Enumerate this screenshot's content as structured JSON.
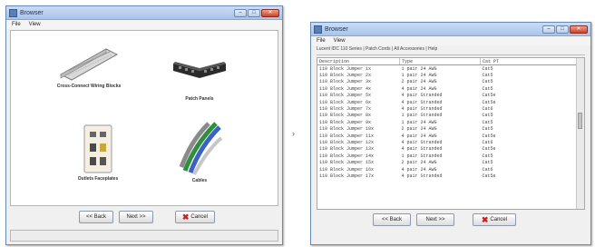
{
  "left_window": {
    "title": "Browser",
    "menu": [
      "File",
      "View"
    ],
    "tiles": [
      "Cross-Connect Wiring Blocks",
      "Patch Panels",
      "Outlets Faceplates",
      "Cables"
    ],
    "buttons": {
      "back": "<< Back",
      "next": "Next >>",
      "cancel": "Cancel"
    }
  },
  "right_window": {
    "title": "Browser",
    "menu": [
      "File",
      "View"
    ],
    "toolbar_text": "Lucent IDC 110 Series | Patch Cords | All Accessories | Help",
    "columns": [
      "Description",
      "Type",
      "Cat PT"
    ],
    "rows": [
      [
        "110 Block Jumper 1x",
        "1 pair 24 AWG",
        "Cat5"
      ],
      [
        "110 Block Jumper 2x",
        "1 pair 24 AWG",
        "Cat5"
      ],
      [
        "110 Block Jumper 3x",
        "2 pair 24 AWG",
        "Cat5"
      ],
      [
        "110 Block Jumper 4x",
        "4 pair 24 AWG",
        "Cat5"
      ],
      [
        "110 Block Jumper 5x",
        "4 pair Stranded",
        "Cat5e"
      ],
      [
        "110 Block Jumper 6x",
        "4 pair Stranded",
        "Cat5e"
      ],
      [
        "110 Block Jumper 7x",
        "4 pair Stranded",
        "Cat6"
      ],
      [
        "110 Block Jumper 8x",
        "1 pair Stranded",
        "Cat5"
      ],
      [
        "110 Block Jumper 9x",
        "1 pair 24 AWG",
        "Cat5"
      ],
      [
        "110 Block Jumper 10x",
        "2 pair 24 AWG",
        "Cat5"
      ],
      [
        "110 Block Jumper 11x",
        "4 pair 24 AWG",
        "Cat5e"
      ],
      [
        "110 Block Jumper 12x",
        "4 pair Stranded",
        "Cat6"
      ],
      [
        "110 Block Jumper 13x",
        "4 pair Stranded",
        "Cat5e"
      ],
      [
        "110 Block Jumper 14x",
        "1 pair Stranded",
        "Cat5"
      ],
      [
        "110 Block Jumper 15x",
        "2 pair 24 AWG",
        "Cat5"
      ],
      [
        "110 Block Jumper 16x",
        "4 pair 24 AWG",
        "Cat6"
      ],
      [
        "110 Block Jumper 17x",
        "4 pair Stranded",
        "Cat5e"
      ]
    ],
    "buttons": {
      "back": "<< Back",
      "next": "Next >>",
      "cancel": "Cancel"
    }
  }
}
